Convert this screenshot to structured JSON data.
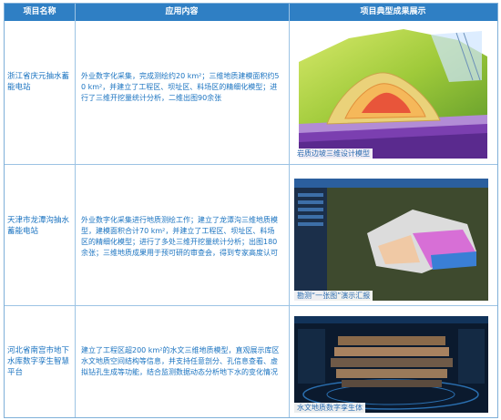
{
  "header": {
    "col1": "项目名称",
    "col2": "应用内容",
    "col3": "项目典型成果展示"
  },
  "rows": [
    {
      "name": "浙江省庆元抽水蓄能电站",
      "content": "外业数字化采集，完成测绘约20 km²；三维地质建模面积约50 km²，并建立了工程区、坝址区、料场区的精细化模型；进行了三维开挖量统计分析，二维出图90余张",
      "caption": "岩质边坡三维设计模型"
    },
    {
      "name": "天津市龙潭沟抽水蓄能电站",
      "content": "外业数字化采集进行地质测绘工作；建立了龙潭沟三维地质模型，建模面积合计70 km²，并建立了工程区、坝址区、料场区的精细化模型；进行了多处三维开挖量统计分析；出图180余张；三维地质成果用于预可研的审查会，得到专家高度认可",
      "caption": "勘测“一张图”演示汇报"
    },
    {
      "name": "河北省南宫市地下水库数字孪生智慧平台",
      "content": "建立了工程区超200 km²的水文三维地质模型，直观展示库区水文地质空间结构等信息，并支持任意剖分、孔信息查看、虚拟钻孔生成等功能，结合监测数据动态分析地下水的变化情况",
      "caption": "水文地质数字孪生体"
    }
  ],
  "colors": {
    "header_bg": "#2f7fc4",
    "text": "#1a73c0",
    "border": "#9cc3e4"
  }
}
